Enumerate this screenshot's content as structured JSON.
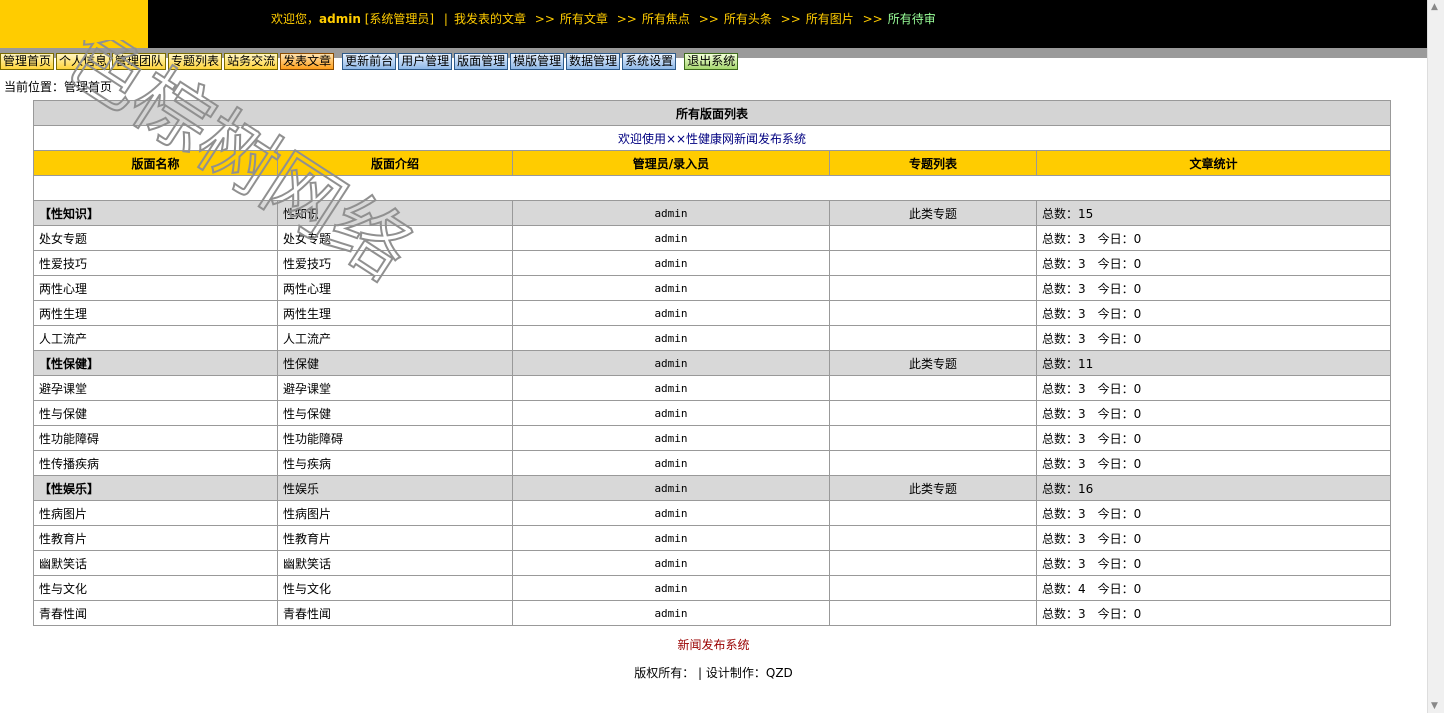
{
  "header": {
    "welcome_prefix": "欢迎您，",
    "username": "admin",
    "role": "[系统管理员]",
    "divider": "|",
    "links": [
      "我发表的文章",
      "所有文章",
      "所有焦点",
      "所有头条",
      "所有图片"
    ],
    "pending_link": "所有待审",
    "arrow": ">>"
  },
  "menu": {
    "group1": [
      "管理首页",
      "个人信息",
      "管理团队",
      "专题列表",
      "站务交流"
    ],
    "post": "发表文章",
    "group2": [
      "更新前台",
      "用户管理",
      "版面管理",
      "模版管理",
      "数据管理",
      "系统设置"
    ],
    "logout": "退出系统"
  },
  "breadcrumb": "当前位置：管理首页",
  "table": {
    "title": "所有版面列表",
    "welcome": "欢迎使用××性健康网新闻发布系统",
    "columns": [
      "版面名称",
      "版面介绍",
      "管理员/录入员",
      "专题列表",
      "文章统计"
    ],
    "rows": [
      {
        "cat": true,
        "name": "【性知识】",
        "intro": "性知识",
        "admin": "admin",
        "topic": "此类专题",
        "stats": "总数：15"
      },
      {
        "cat": false,
        "name": "处女专题",
        "intro": "处女专题",
        "admin": "admin",
        "topic": "",
        "stats": "总数：3　今日：0"
      },
      {
        "cat": false,
        "name": "性爱技巧",
        "intro": "性爱技巧",
        "admin": "admin",
        "topic": "",
        "stats": "总数：3　今日：0"
      },
      {
        "cat": false,
        "name": "两性心理",
        "intro": "两性心理",
        "admin": "admin",
        "topic": "",
        "stats": "总数：3　今日：0"
      },
      {
        "cat": false,
        "name": "两性生理",
        "intro": "两性生理",
        "admin": "admin",
        "topic": "",
        "stats": "总数：3　今日：0"
      },
      {
        "cat": false,
        "name": "人工流产",
        "intro": "人工流产",
        "admin": "admin",
        "topic": "",
        "stats": "总数：3　今日：0"
      },
      {
        "cat": true,
        "name": "【性保健】",
        "intro": "性保健",
        "admin": "admin",
        "topic": "此类专题",
        "stats": "总数：11"
      },
      {
        "cat": false,
        "name": "避孕课堂",
        "intro": "避孕课堂",
        "admin": "admin",
        "topic": "",
        "stats": "总数：3　今日：0"
      },
      {
        "cat": false,
        "name": "性与保健",
        "intro": "性与保健",
        "admin": "admin",
        "topic": "",
        "stats": "总数：3　今日：0"
      },
      {
        "cat": false,
        "name": "性功能障碍",
        "intro": "性功能障碍",
        "admin": "admin",
        "topic": "",
        "stats": "总数：3　今日：0"
      },
      {
        "cat": false,
        "name": "性传播疾病",
        "intro": "性与疾病",
        "admin": "admin",
        "topic": "",
        "stats": "总数：3　今日：0"
      },
      {
        "cat": true,
        "name": "【性娱乐】",
        "intro": "性娱乐",
        "admin": "admin",
        "topic": "此类专题",
        "stats": "总数：16"
      },
      {
        "cat": false,
        "name": "性病图片",
        "intro": "性病图片",
        "admin": "admin",
        "topic": "",
        "stats": "总数：3　今日：0"
      },
      {
        "cat": false,
        "name": "性教育片",
        "intro": "性教育片",
        "admin": "admin",
        "topic": "",
        "stats": "总数：3　今日：0"
      },
      {
        "cat": false,
        "name": "幽默笑话",
        "intro": "幽默笑话",
        "admin": "admin",
        "topic": "",
        "stats": "总数：3　今日：0"
      },
      {
        "cat": false,
        "name": "性与文化",
        "intro": "性与文化",
        "admin": "admin",
        "topic": "",
        "stats": "总数：4　今日：0"
      },
      {
        "cat": false,
        "name": "青春性闻",
        "intro": "青春性闻",
        "admin": "admin",
        "topic": "",
        "stats": "总数：3　今日：0"
      }
    ]
  },
  "footer": {
    "system_name": "新闻发布系统",
    "copyright": "版权所有：  |  设计制作：QZD"
  },
  "watermark": {
    "text": "色棕树网络"
  },
  "colors": {
    "accent_yellow": "#ffcc00",
    "header_bg": "#000000",
    "category_row": "#d8d8d8",
    "footer_red": "#990000"
  }
}
